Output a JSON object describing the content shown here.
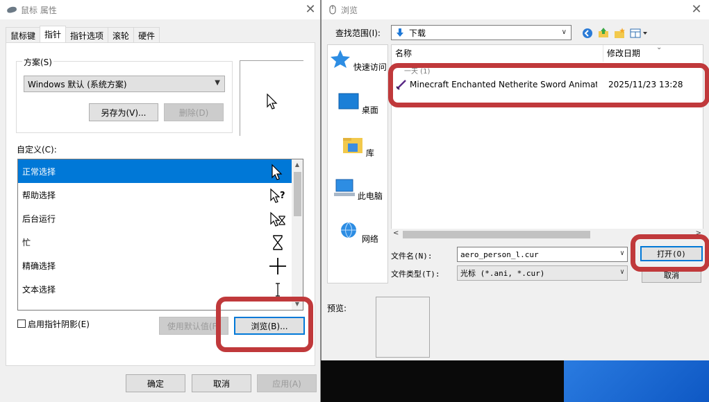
{
  "mouse_window": {
    "title": "鼠标 属性",
    "tabs": [
      "鼠标键",
      "指针",
      "指针选项",
      "滚轮",
      "硬件"
    ],
    "scheme_group_label": "方案(S)",
    "scheme_selected": "Windows 默认 (系统方案)",
    "save_as_label": "另存为(V)...",
    "delete_label": "删除(D)",
    "customize_label": "自定义(C):",
    "cursor_items": [
      "正常选择",
      "帮助选择",
      "后台运行",
      "忙",
      "精确选择",
      "文本选择"
    ],
    "shadow_checkbox_label": "启用指针阴影(E)",
    "use_default_label": "使用默认值(F)",
    "browse_label": "浏览(B)...",
    "ok_label": "确定",
    "cancel_label": "取消",
    "apply_label": "应用(A)"
  },
  "browse_window": {
    "title": "浏览",
    "look_in_label": "查找范围(I):",
    "look_in_value": "下载",
    "nav_items": [
      "快速访问",
      "桌面",
      "库",
      "此电脑",
      "网络"
    ],
    "columns": [
      "名称",
      "修改日期"
    ],
    "group_partial": "一天 (1)",
    "files": [
      {
        "name": "Minecraft Enchanted Netherite Sword Animat...",
        "modified": "2025/11/23 13:28"
      }
    ],
    "filename_label": "文件名(N):",
    "filename_value": "aero_person_l.cur",
    "filetype_label": "文件类型(T):",
    "filetype_value": "光标 (*.ani, *.cur)",
    "open_label": "打开(O)",
    "cancel_label": "取消",
    "preview_label": "预览:"
  },
  "colors": {
    "highlight": "#c0393b",
    "selection": "#0078d7"
  }
}
